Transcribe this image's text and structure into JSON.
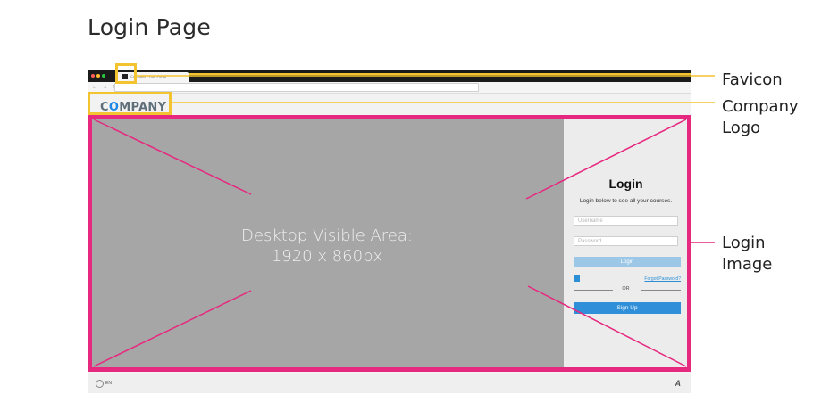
{
  "title": "Login Page",
  "browser": {
    "tab_title": "Company | Your Portal"
  },
  "site": {
    "logo_pre": "C",
    "logo_o": "O",
    "logo_post": "MPANY"
  },
  "hero": {
    "line1": "Desktop Visible Area:",
    "line2": "1920 x 860px"
  },
  "login_panel": {
    "heading": "Login",
    "subtitle": "Login below to see all your courses.",
    "username_placeholder": "Username",
    "password_placeholder": "Password",
    "login_button": "Login",
    "forgot_link": "Forgot Password?",
    "or_text": "OR",
    "signup_button": "Sign Up"
  },
  "footer": {
    "language": "EN",
    "brand_mark": "A"
  },
  "callouts": {
    "favicon": "Favicon",
    "company_logo_line1": "Company",
    "company_logo_line2": "Logo",
    "login_image_line1": "Login",
    "login_image_line2": "Image"
  },
  "colors": {
    "highlight": "#f4c430",
    "frame": "#e6287f",
    "accent": "#2f8fd8"
  }
}
